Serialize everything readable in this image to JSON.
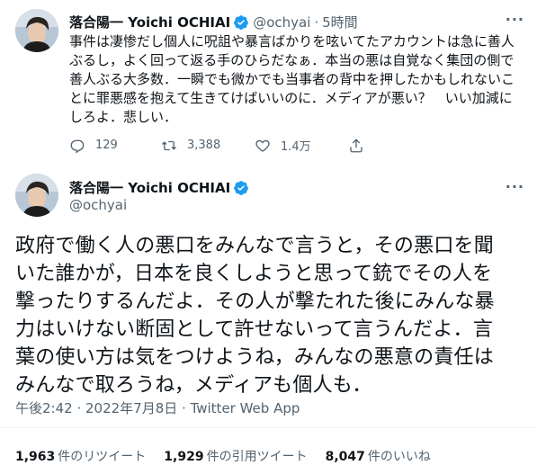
{
  "tweet1": {
    "author_name": "落合陽一 Yoichi OCHIAI",
    "handle": "@ochyai",
    "time": "5時間",
    "lines": [
      "事件は凄惨だし個人に呪詛や暴言ばかりを呟いてたアカウントは急に善人",
      "ぶるし，よく回って返る手のひらだなぁ．本当の悪は自覚なく集団の側で",
      "善人ぶる大多数．一瞬でも微かでも当事者の背中を押したかもしれないこ",
      "とに罪悪感を抱えて生きてけばいいのに．メディアが悪い？　いい加減に",
      "しろよ．悲しい．"
    ],
    "actions": {
      "reply_count": "129",
      "retweet_count": "3,388",
      "like_count": "1.4万"
    }
  },
  "tweet2": {
    "author_name": "落合陽一 Yoichi OCHIAI",
    "handle": "@ochyai",
    "lines": [
      "政府で働く人の悪口をみんなで言うと，その悪口を聞",
      "いた誰かが，日本を良くしようと思って銃でその人を",
      "撃ったりするんだよ．その人が撃たれた後にみんな暴",
      "力はいけない断固として許せないって言うんだよ．言",
      "葉の使い方は気をつけようね，みんなの悪意の責任は",
      "みんなで取ろうね，メディアも個人も．"
    ],
    "timestamp": "午後2:42 · 2022年7月8日 · ",
    "source": "Twitter Web App",
    "stats": [
      {
        "num": "1,963",
        "label": "件のリツイート"
      },
      {
        "num": "1,929",
        "label": "件の引用ツイート"
      },
      {
        "num": "8,047",
        "label": "件のいいね"
      }
    ]
  },
  "icons": {
    "verified": "verified-badge-icon",
    "reply": "reply-icon",
    "retweet": "retweet-icon",
    "like": "heart-icon",
    "share": "share-icon",
    "more": "more-icon"
  },
  "colors": {
    "verified_blue": "#1d9bf0",
    "secondary_text": "#536471",
    "primary_text": "#0f1419"
  }
}
